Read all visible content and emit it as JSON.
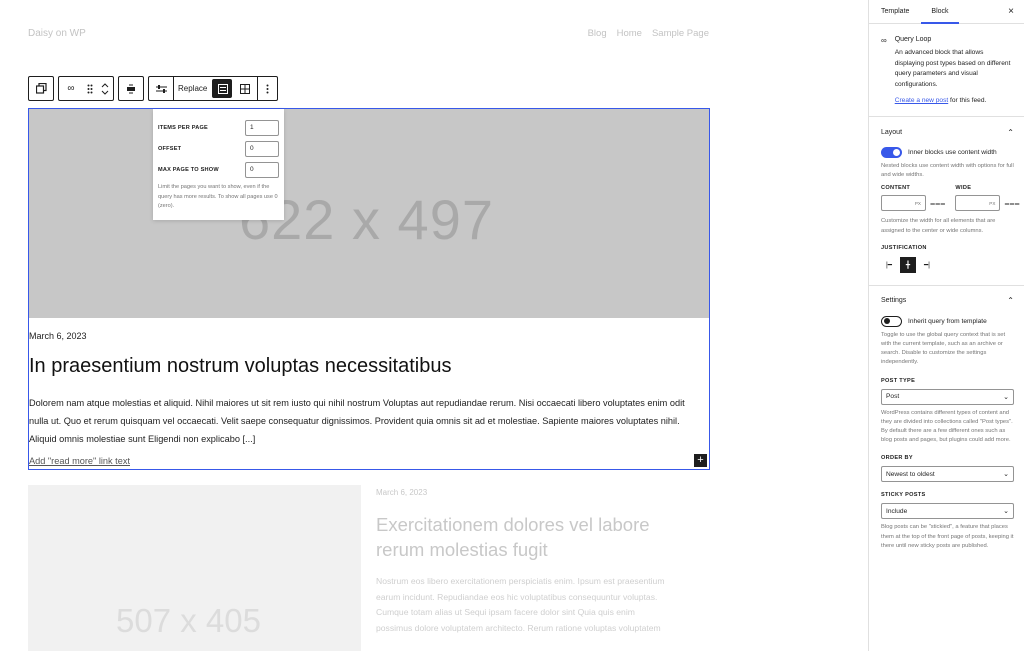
{
  "site": {
    "title": "Daisy on WP",
    "nav": [
      "Blog",
      "Home",
      "Sample Page"
    ]
  },
  "toolbar": {
    "replace_label": "Replace",
    "icons": [
      "block-parent-icon",
      "query-loop-icon",
      "drag-handle-icon",
      "move-arrows-icon",
      "align-icon",
      "settings-sliders-icon",
      "list-view-icon",
      "grid-view-icon",
      "more-options-icon"
    ]
  },
  "popover": {
    "items_label": "ITEMS PER PAGE",
    "items_value": "1",
    "offset_label": "OFFSET",
    "offset_value": "0",
    "maxpage_label": "MAX PAGE TO SHOW",
    "maxpage_value": "0",
    "help": "Limit the pages you want to show, even if the query has more results. To show all pages use 0 (zero)."
  },
  "post1": {
    "image_placeholder": "622 x 497",
    "date": "March 6, 2023",
    "title": "In praesentium nostrum voluptas necessitatibus",
    "excerpt": "Dolorem nam atque molestias et aliquid. Nihil maiores ut sit rem iusto qui nihil nostrum Voluptas aut repudiandae rerum. Nisi occaecati libero voluptates enim odit nulla ut. Quo et rerum quisquam vel occaecati. Velit saepe consequatur dignissimos. Provident quia omnis sit ad et molestiae. Sapiente maiores voluptates nihil. Aliquid omnis molestiae sunt Eligendi non explicabo [...]",
    "read_more": "Add \"read more\" link text",
    "add_icon": "+"
  },
  "post2": {
    "image_placeholder": "507 x 405",
    "date": "March 6, 2023",
    "title": "Exercitationem dolores vel labore rerum molestias fugit",
    "excerpt": "Nostrum eos libero exercitationem perspiciatis enim. Ipsum est praesentium earum incidunt. Repudiandae eos hic voluptatibus consequuntur voluptas. Cumque totam alias ut Sequi ipsam facere dolor sint Quia quis enim possimus dolore voluptatem architecto. Rerum ratione voluptas voluptatem"
  },
  "sidebar": {
    "tabs": [
      "Template",
      "Block"
    ],
    "close": "×",
    "block_name": "Query Loop",
    "block_desc": "An advanced block that allows displaying post types based on different query parameters and visual configurations.",
    "create_link": "Create a new post",
    "create_suffix": " for this feed.",
    "layout": {
      "title": "Layout",
      "toggle_label": "Inner blocks use content width",
      "toggle_help": "Nested blocks use content width with options for full and wide widths.",
      "content_label": "CONTENT",
      "wide_label": "WIDE",
      "unit": "PX",
      "width_help": "Customize the width for all elements that are assigned to the center or wide columns.",
      "justification_label": "JUSTIFICATION"
    },
    "settings": {
      "title": "Settings",
      "inherit_label": "Inherit query from template",
      "inherit_help": "Toggle to use the global query context that is set with the current template, such as an archive or search. Disable to customize the settings independently.",
      "post_type_label": "POST TYPE",
      "post_type_value": "Post",
      "post_type_help": "WordPress contains different types of content and they are divided into collections called \"Post types\". By default there are a few different ones such as blog posts and pages, but plugins could add more.",
      "order_by_label": "ORDER BY",
      "order_by_value": "Newest to oldest",
      "sticky_label": "STICKY POSTS",
      "sticky_value": "Include",
      "sticky_help": "Blog posts can be \"stickied\", a feature that places them at the top of the front page of posts, keeping it there until new sticky posts are published."
    }
  },
  "colors": {
    "accent": "#3858e9",
    "dark": "#1e1e1e",
    "muted": "#757575"
  }
}
